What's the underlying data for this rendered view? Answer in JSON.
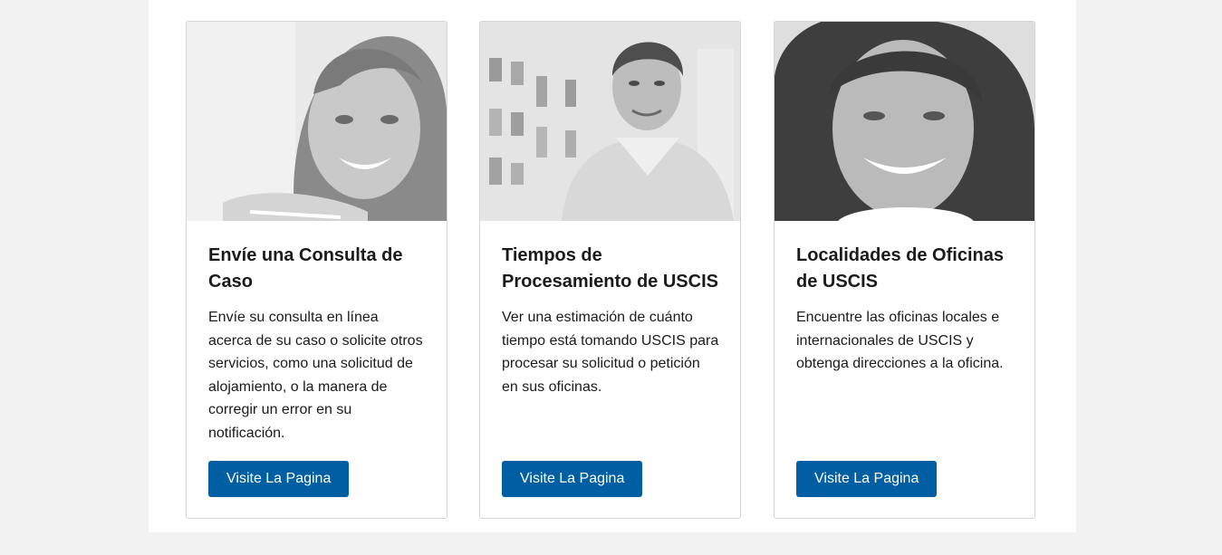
{
  "cards": [
    {
      "image_alt": "woman-smiling-photo",
      "title": "Envíe una Consulta de Caso",
      "description": "Envíe su consulta en línea acerca de su caso o solicite otros servicios, como una solicitud de alojamiento, o la manera de corregir un error en su notificación.",
      "button_label": "Visite La Pagina"
    },
    {
      "image_alt": "man-smiling-photo",
      "title": "Tiempos de Procesamiento de USCIS",
      "description": "Ver una estimación de cuánto tiempo está tomando USCIS para procesar su solicitud o petición en sus oficinas.",
      "button_label": "Visite La Pagina"
    },
    {
      "image_alt": "older-woman-smiling-photo",
      "title": "Localidades de Oficinas de USCIS",
      "description": "Encuentre las oficinas locales e internacionales de USCIS y obtenga direcciones a la oficina.",
      "button_label": "Visite La Pagina"
    }
  ],
  "colors": {
    "button": "#005ea2",
    "page_background": "#f2f2f2",
    "panel_background": "#ffffff"
  }
}
